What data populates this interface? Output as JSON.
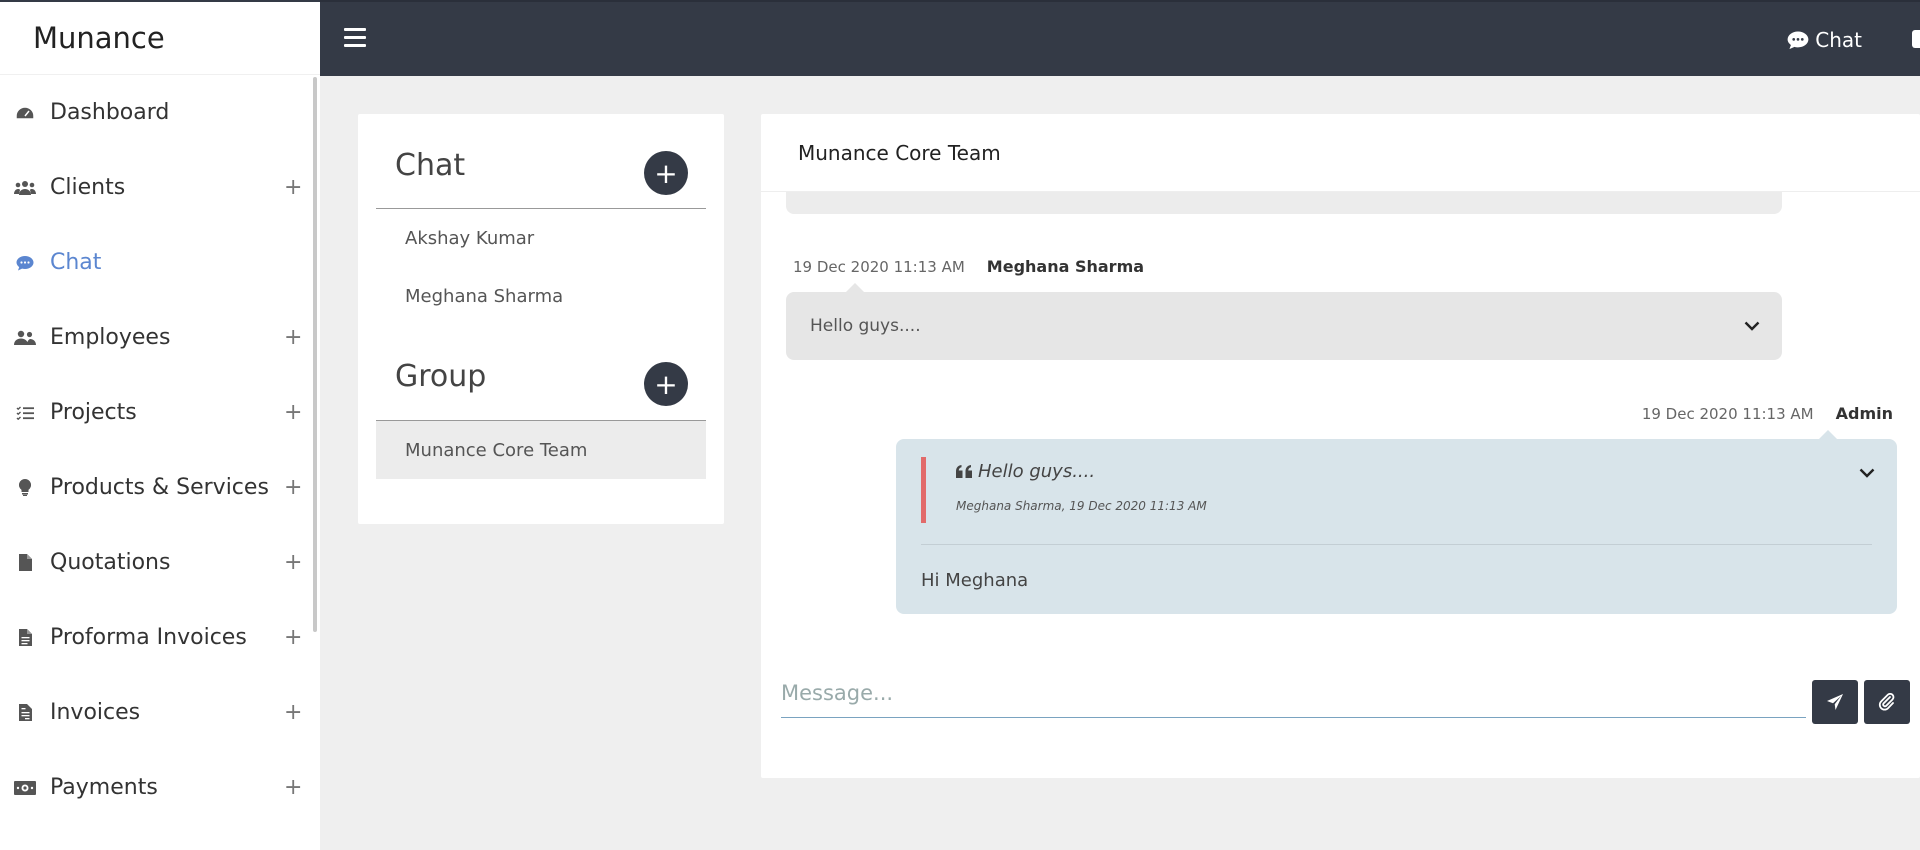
{
  "app": {
    "brand": "Munance"
  },
  "sidebar": {
    "items": [
      {
        "label": "Dashboard",
        "icon": "dashboard-icon",
        "has_submenu": false
      },
      {
        "label": "Clients",
        "icon": "users-icon",
        "has_submenu": true
      },
      {
        "label": "Chat",
        "icon": "chat-bubble-icon",
        "has_submenu": false,
        "active": true
      },
      {
        "label": "Employees",
        "icon": "employees-icon",
        "has_submenu": true
      },
      {
        "label": "Projects",
        "icon": "list-icon",
        "has_submenu": true
      },
      {
        "label": "Products & Services",
        "icon": "lightbulb-icon",
        "has_submenu": true
      },
      {
        "label": "Quotations",
        "icon": "file-icon",
        "has_submenu": true
      },
      {
        "label": "Proforma Invoices",
        "icon": "file-text-icon",
        "has_submenu": true
      },
      {
        "label": "Invoices",
        "icon": "invoice-icon",
        "has_submenu": true
      },
      {
        "label": "Payments",
        "icon": "money-icon",
        "has_submenu": true
      }
    ],
    "plus_symbol": "+"
  },
  "topbar": {
    "chat_label": "Chat"
  },
  "chat_list": {
    "chat_title": "Chat",
    "contacts": [
      "Akshay Kumar",
      "Meghana Sharma"
    ],
    "group_title": "Group",
    "groups": [
      "Munance Core Team"
    ],
    "add_symbol": "+"
  },
  "conversation": {
    "title": "Munance Core Team",
    "messages": [
      {
        "time": "19 Dec 2020 11:13 AM",
        "sender": "Meghana Sharma",
        "text": "Hello guys...."
      },
      {
        "time": "19 Dec 2020 11:13 AM",
        "sender": "Admin",
        "quote_text": "Hello guys....",
        "quote_meta": "Meghana Sharma, 19 Dec 2020 11:13 AM",
        "text": "Hi Meghana"
      }
    ],
    "input_placeholder": "Message..."
  },
  "colors": {
    "topbar": "#343a46",
    "active_nav": "#5b86d0",
    "quote_bar": "#e26a6a",
    "outgoing_bubble": "#d8e4ea",
    "incoming_bubble": "#e6e6e6"
  }
}
